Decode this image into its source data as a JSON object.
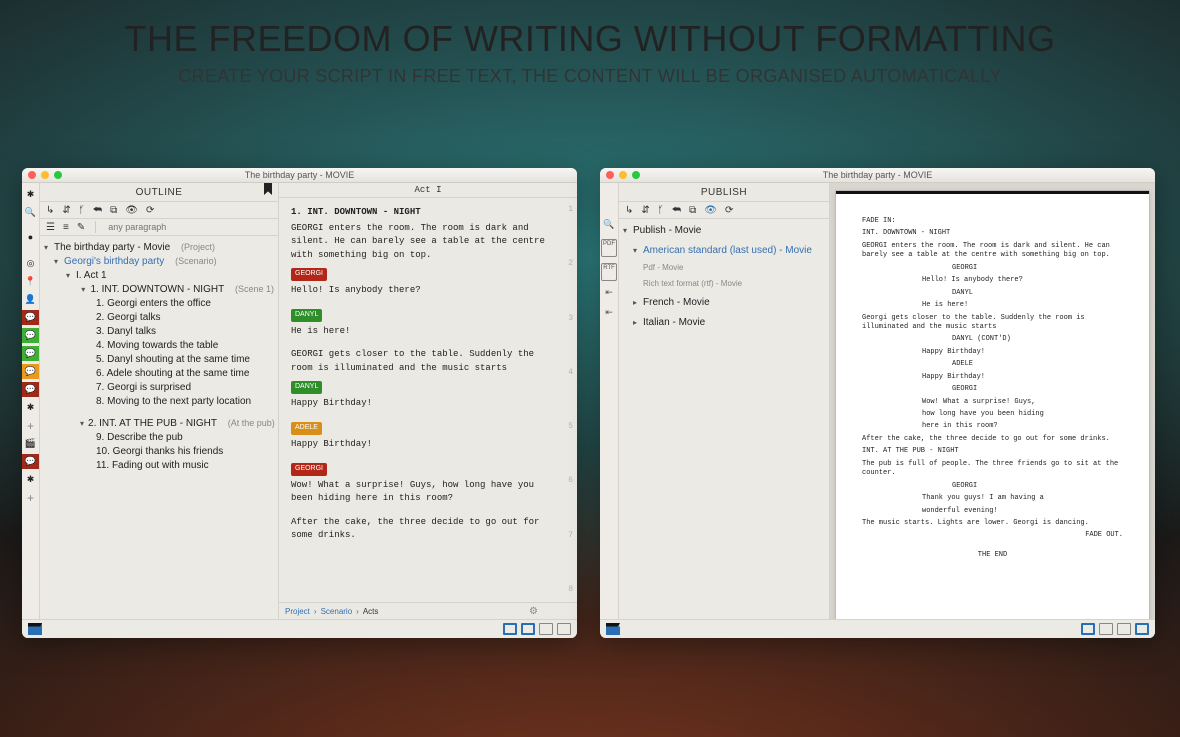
{
  "hero": {
    "title": "THE FREEDOM OF WRITING WITHOUT FORMATTING",
    "subtitle": "CREATE YOUR SCRIPT IN FREE TEXT, THE CONTENT WILL BE ORGANISED AUTOMATICALLY"
  },
  "window_a": {
    "title": "The birthday party - MOVIE",
    "panel_title": "OUTLINE",
    "search_placeholder": "any paragraph",
    "tree": {
      "root": "The birthday party - Movie",
      "root_meta": "(Project)",
      "scenario": "Georgi's birthday party",
      "scenario_meta": "(Scenario)",
      "act1": "I. Act 1",
      "scene1": "1. INT.  DOWNTOWN - NIGHT",
      "scene1_meta": "(Scene 1)",
      "items1": [
        "1. Georgi enters the office",
        "2. Georgi talks",
        "3. Danyl talks",
        "4. Moving towards the table",
        "5. Danyl shouting at the same time",
        "6. Adele shouting at the same time",
        "7. Georgi is surprised",
        "8. Moving to the next party location"
      ],
      "scene2": "2. INT.  AT THE PUB - NIGHT",
      "scene2_meta": "(At the pub)",
      "items2": [
        "9. Describe the pub",
        "10. Georgi thanks his friends",
        "11. Fading out with music"
      ]
    },
    "editor": {
      "act_heading": "Act I",
      "slug1": "1. INT.  DOWNTOWN - NIGHT",
      "action1": "GEORGI enters the room. The room is dark and silent. He can barely see a table at the centre with something big on top.",
      "georgi_tag": "GEORGI",
      "line_georgi1": "Hello! Is anybody there?",
      "danyl_tag": "DANYL",
      "line_danyl1": "He is here!",
      "action2": "GEORGI gets closer to the table. Suddenly the room is illuminated and the music starts",
      "line_danyl2": "Happy Birthday!",
      "adele_tag": "ADELE",
      "line_adele": "Happy Birthday!",
      "line_georgi2": "Wow! What a surprise! Guys, how long have you been hiding here in this room?",
      "action3": "After the cake, the three decide to go out for some drinks.",
      "gutter": [
        "1",
        "2",
        "3",
        "4",
        "5",
        "6",
        "7",
        "8"
      ],
      "crumb": {
        "a": "Project",
        "b": "Scenario",
        "c": "Acts"
      }
    }
  },
  "window_b": {
    "title": "The birthday party - MOVIE",
    "panel_title": "PUBLISH",
    "tree": {
      "root": "Publish - Movie",
      "row1": "American standard (last used) - Movie",
      "row_pdf": "Pdf - Movie",
      "row_rtf": "Rich text format (rtf) - Movie",
      "row_fr": "French - Movie",
      "row_it": "Italian - Movie"
    },
    "script": {
      "fadein": "FADE IN:",
      "slug1": "INT. DOWNTOWN - NIGHT",
      "a1": "GEORGI enters the room. The room is dark and silent. He can barely see a table at the centre with something big on top.",
      "ch_g": "GEORGI",
      "d_g1": "Hello! Is anybody there?",
      "ch_d": "DANYL",
      "d_d1": "He is here!",
      "a2": "Georgi gets closer to the table. Suddenly the room is illuminated and the music starts",
      "ch_dcont": "DANYL (CONT'D)",
      "d_d2": "Happy Birthday!",
      "ch_a": "ADELE",
      "d_a": "Happy Birthday!",
      "ch_g2": "GEORGI",
      "d_g2a": "Wow! What a surprise! Guys,",
      "d_g2b": "how long have you been hiding",
      "d_g2c": "here in this room?",
      "a3": "After the cake, the three decide to go out for some drinks.",
      "slug2": "INT. AT THE PUB - NIGHT",
      "a4": "The pub is full of people. The three friends go to sit at the counter.",
      "ch_g3": "GEORGI",
      "d_g3a": "Thank you guys! I am having a",
      "d_g3b": "wonderful evening!",
      "a5": "The music starts. Lights are lower. Georgi is dancing.",
      "fadeout": "FADE OUT.",
      "end": "THE END"
    }
  }
}
